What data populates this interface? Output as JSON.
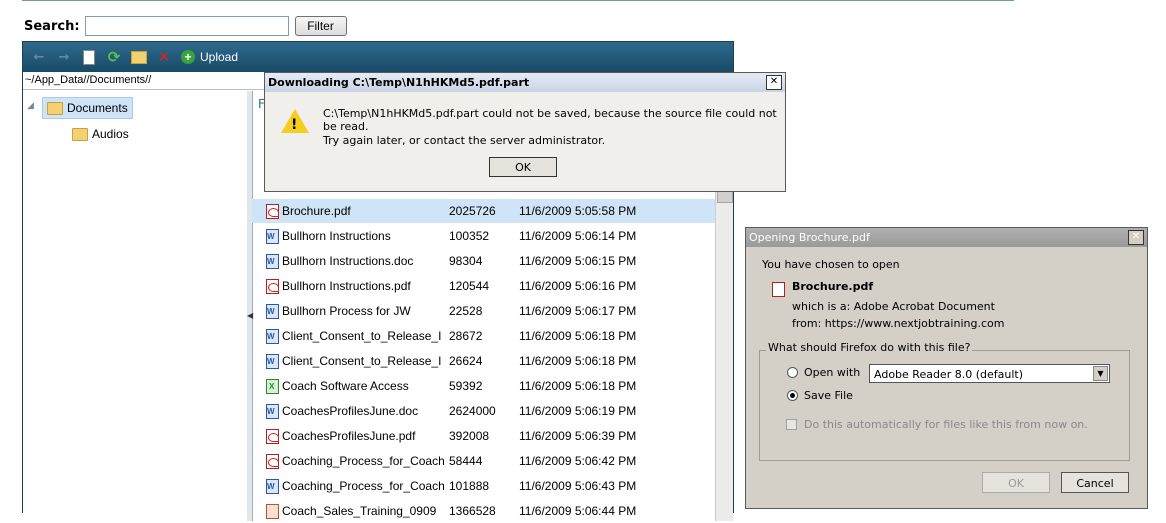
{
  "search": {
    "label": "Search:",
    "value": "",
    "filter_label": "Filter"
  },
  "toolbar": {
    "upload_label": "Upload"
  },
  "path": "~/App_Data//Documents//",
  "tree": {
    "items": [
      {
        "label": "Documents"
      },
      {
        "label": "Audios"
      }
    ]
  },
  "list": {
    "header_partial": "F",
    "rows": [
      {
        "name": "Brochure.pdf",
        "size": "2025726",
        "date": "11/6/2009 5:05:58 PM",
        "type": "pdf"
      },
      {
        "name": "Bullhorn Instructions",
        "size": "100352",
        "date": "11/6/2009 5:06:14 PM",
        "type": "doc"
      },
      {
        "name": "Bullhorn Instructions.doc",
        "size": "98304",
        "date": "11/6/2009 5:06:15 PM",
        "type": "doc"
      },
      {
        "name": "Bullhorn Instructions.pdf",
        "size": "120544",
        "date": "11/6/2009 5:06:16 PM",
        "type": "pdf"
      },
      {
        "name": "Bullhorn Process for JW",
        "size": "22528",
        "date": "11/6/2009 5:06:17 PM",
        "type": "doc"
      },
      {
        "name": "Client_Consent_to_Release_I",
        "size": "28672",
        "date": "11/6/2009 5:06:18 PM",
        "type": "doc"
      },
      {
        "name": "Client_Consent_to_Release_I",
        "size": "26624",
        "date": "11/6/2009 5:06:18 PM",
        "type": "doc"
      },
      {
        "name": "Coach Software Access",
        "size": "59392",
        "date": "11/6/2009 5:06:18 PM",
        "type": "xls"
      },
      {
        "name": "CoachesProfilesJune.doc",
        "size": "2624000",
        "date": "11/6/2009 5:06:19 PM",
        "type": "doc"
      },
      {
        "name": "CoachesProfilesJune.pdf",
        "size": "392008",
        "date": "11/6/2009 5:06:39 PM",
        "type": "pdf"
      },
      {
        "name": "Coaching_Process_for_Coach",
        "size": "58444",
        "date": "11/6/2009 5:06:42 PM",
        "type": "pdf"
      },
      {
        "name": "Coaching_Process_for_Coach",
        "size": "101888",
        "date": "11/6/2009 5:06:43 PM",
        "type": "doc"
      },
      {
        "name": "Coach_Sales_Training_0909",
        "size": "1366528",
        "date": "11/6/2009 5:06:44 PM",
        "type": "ppt"
      }
    ]
  },
  "download_error": {
    "title": "Downloading C:\\Temp\\N1hHKMd5.pdf.part",
    "message": "C:\\Temp\\N1hHKMd5.pdf.part could not be saved, because the source file could not be read.",
    "hint": "Try again later, or contact the server administrator.",
    "ok_label": "OK"
  },
  "open_dialog": {
    "title": "Opening Brochure.pdf",
    "intro": "You have chosen to open",
    "filename": "Brochure.pdf",
    "which_is": "which is a:  Adobe Acrobat Document",
    "from": "from:  https://www.nextjobtraining.com",
    "question": "What should Firefox do with this file?",
    "open_with_label": "Open with",
    "open_with_value": "Adobe Reader 8.0 (default)",
    "save_file_label": "Save File",
    "auto_label": "Do this automatically for files like this from now on.",
    "ok_label": "OK",
    "cancel_label": "Cancel"
  },
  "colors": {
    "toolbar": "#1f5878",
    "selection": "#cfe4f7",
    "dialog_bg": "#d4d0c8"
  }
}
